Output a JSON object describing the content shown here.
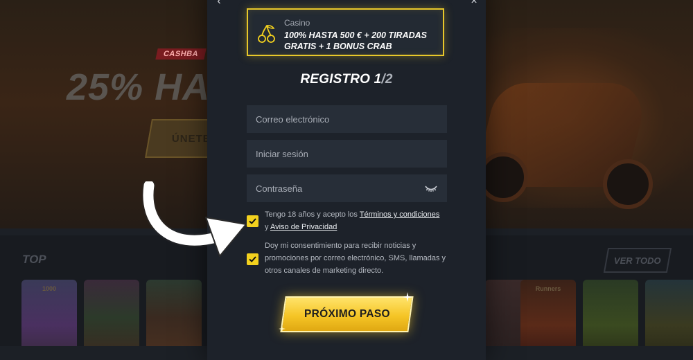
{
  "background": {
    "cashback_label": "CASHBA",
    "hero_text": "25% HAS",
    "join_label": "ÚNETE",
    "section_title": "TOP",
    "see_all_label": "VER TODO",
    "game_tile_1_caption": "1000",
    "game_tile_6_caption": "Runners"
  },
  "modal": {
    "bonus": {
      "category": "Casino",
      "offer": "100% HASTA 500 € + 200 TIRADAS GRATIS + 1 BONUS CRAB",
      "icon": "cherry-icon"
    },
    "title": "REGISTRO 1",
    "title_step": "/2",
    "fields": {
      "email_placeholder": "Correo electrónico",
      "login_placeholder": "Iniciar sesión",
      "password_placeholder": "Contraseña"
    },
    "terms": {
      "text_before": "Tengo 18 años y acepto los ",
      "terms_link": "Términos y condiciones",
      "text_mid": "y ",
      "privacy_link": "Aviso de Privacidad"
    },
    "marketing": {
      "text": "Doy mi consentimiento para recibir noticias y promociones por correo electrónico, SMS, llamadas y otros canales de marketing directo."
    },
    "next_label": "PRÓXIMO PASO"
  },
  "colors": {
    "accent": "#f3d11e",
    "modal_bg": "#1d222a",
    "field_bg": "#272e38"
  }
}
